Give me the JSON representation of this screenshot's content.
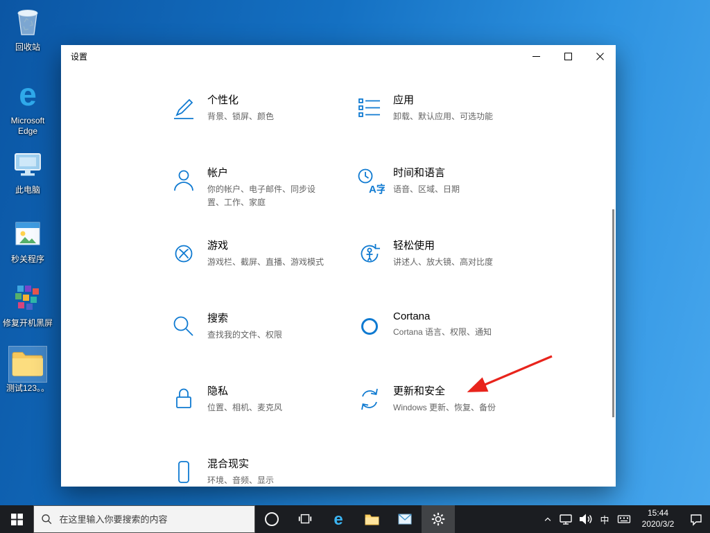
{
  "desktop": {
    "icons": [
      {
        "label": "回收站"
      },
      {
        "label": "Microsoft Edge"
      },
      {
        "label": "此电脑"
      },
      {
        "label": "秒关程序"
      },
      {
        "label": "修复开机黑屏"
      },
      {
        "label": "测试123。。"
      }
    ]
  },
  "window": {
    "title": "设置",
    "categories": [
      {
        "name": "个性化",
        "desc": "背景、锁屏、颜色"
      },
      {
        "name": "应用",
        "desc": "卸载、默认应用、可选功能"
      },
      {
        "name": "帐户",
        "desc": "你的帐户、电子邮件、同步设置、工作、家庭"
      },
      {
        "name": "时间和语言",
        "desc": "语音、区域、日期"
      },
      {
        "name": "游戏",
        "desc": "游戏栏、截屏、直播、游戏模式"
      },
      {
        "name": "轻松使用",
        "desc": "讲述人、放大镜、高对比度"
      },
      {
        "name": "搜索",
        "desc": "查找我的文件、权限"
      },
      {
        "name": "Cortana",
        "desc": "Cortana 语言、权限、通知"
      },
      {
        "name": "隐私",
        "desc": "位置、相机、麦克风"
      },
      {
        "name": "更新和安全",
        "desc": "Windows 更新、恢复、备份"
      },
      {
        "name": "混合现实",
        "desc": "环境、音频、显示"
      }
    ]
  },
  "taskbar": {
    "search_placeholder": "在这里输入你要搜索的内容",
    "ime_label": "中",
    "time": "15:44",
    "date": "2020/3/2"
  },
  "colors": {
    "accent": "#0f7ad1",
    "annotation_arrow": "#e8241c"
  }
}
